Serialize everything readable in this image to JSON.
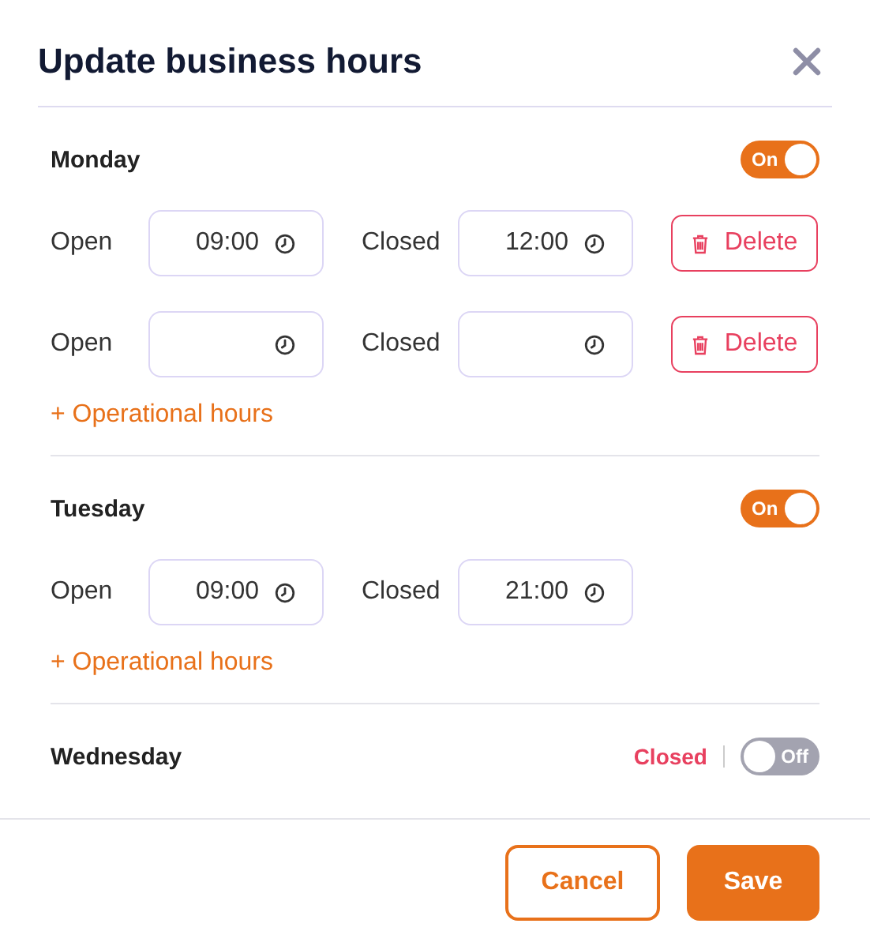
{
  "dialog": {
    "title": "Update business hours"
  },
  "days": [
    {
      "name": "Monday",
      "on": true,
      "toggle_label": "On",
      "slots": [
        {
          "open_label": "Open",
          "open": "09:00",
          "closed_label": "Closed",
          "closed": "12:00",
          "delete": "Delete"
        },
        {
          "open_label": "Open",
          "closed_label": "Closed",
          "delete": "Delete"
        }
      ],
      "add_link": "+ Operational hours"
    },
    {
      "name": "Tuesday",
      "on": true,
      "toggle_label": "On",
      "slots": [
        {
          "open_label": "Open",
          "open": "09:00",
          "closed_label": "Closed",
          "closed": "21:00"
        }
      ],
      "add_link": "+ Operational hours"
    },
    {
      "name": "Wednesday",
      "on": false,
      "toggle_label": "Off",
      "status": "Closed"
    }
  ],
  "footer": {
    "buttons": [
      {
        "label": "Cancel",
        "kind": "secondary"
      },
      {
        "label": "Save",
        "kind": "primary"
      }
    ]
  }
}
